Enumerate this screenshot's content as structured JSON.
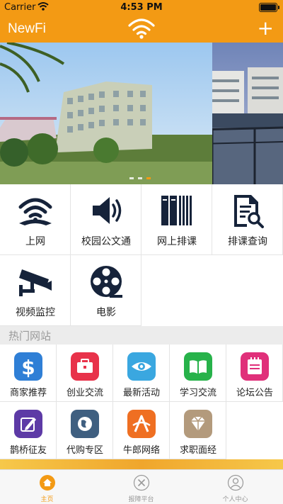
{
  "status_bar": {
    "carrier": "Carrier",
    "time": "4:53 PM"
  },
  "nav": {
    "title": "NewFi",
    "add_label": "+"
  },
  "banner": {
    "page_count": 3,
    "active_page": 3
  },
  "services": [
    {
      "label": "上网",
      "icon": "wifi-icon"
    },
    {
      "label": "校园公文通",
      "icon": "speaker-icon"
    },
    {
      "label": "网上排课",
      "icon": "books-icon"
    },
    {
      "label": "排课查询",
      "icon": "document-search-icon"
    },
    {
      "label": "视频监控",
      "icon": "cctv-camera-icon"
    },
    {
      "label": "电影",
      "icon": "film-reel-icon"
    }
  ],
  "hot_sites": {
    "title": "热门网站",
    "items": [
      {
        "label": "商家推荐",
        "icon": "dollar-icon",
        "color": "#2f7fd6"
      },
      {
        "label": "创业交流",
        "icon": "briefcase-icon",
        "color": "#e8324a"
      },
      {
        "label": "最新活动",
        "icon": "eye-icon",
        "color": "#3aa7e0"
      },
      {
        "label": "学习交流",
        "icon": "open-book-icon",
        "color": "#27b24a"
      },
      {
        "label": "论坛公告",
        "icon": "notepad-icon",
        "color": "#e0307a"
      },
      {
        "label": "鹊桥征友",
        "icon": "pen-edit-icon",
        "color": "#5d3aa6"
      },
      {
        "label": "代购专区",
        "icon": "globe-icon",
        "color": "#3f5f80"
      },
      {
        "label": "牛郎网络",
        "icon": "brand-a-icon",
        "color": "#ef6f22"
      },
      {
        "label": "求职面经",
        "icon": "diamond-icon",
        "color": "#b39a7c"
      }
    ]
  },
  "tabs": [
    {
      "label": "主页",
      "icon": "home-icon",
      "active": true
    },
    {
      "label": "报障平台",
      "icon": "tools-icon",
      "active": false
    },
    {
      "label": "个人中心",
      "icon": "user-icon",
      "active": false
    }
  ]
}
